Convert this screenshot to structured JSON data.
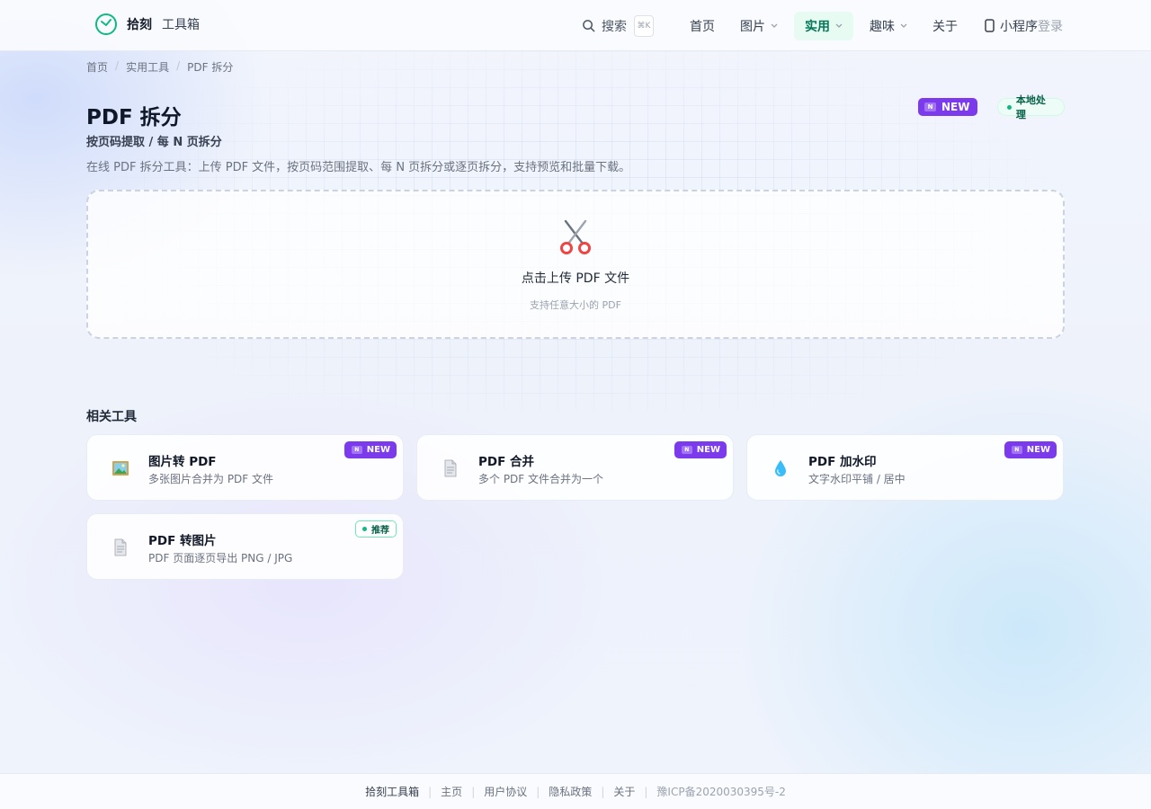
{
  "header": {
    "brand": "拾刻",
    "brand_sub": "工具箱",
    "search_label": "搜索",
    "search_shortcut": "⌘K",
    "nav": [
      "首页",
      "图片",
      "实用",
      "趣味",
      "关于"
    ],
    "mini_program": "小程序",
    "login": "登录",
    "accent": "#10b981"
  },
  "breadcrumb": [
    "首页",
    "实用工具",
    "PDF 拆分"
  ],
  "page": {
    "title": "PDF 拆分",
    "subtitle": "按页码提取 / 每 N 页拆分",
    "description": "在线 PDF 拆分工具：上传 PDF 文件，按页码范围提取、每 N 页拆分或逐页拆分，支持预览和批量下载。",
    "badge_new": "NEW",
    "badge_new_mark": "N",
    "badge_local": "本地处理"
  },
  "upload": {
    "icon": "scissors-icon",
    "title": "点击上传 PDF 文件",
    "hint": "支持任意大小的 PDF"
  },
  "related": {
    "title": "相关工具",
    "items": [
      {
        "name": "图片转 PDF",
        "desc": "多张图片合并为 PDF 文件",
        "badge": "NEW",
        "badge_mark": "N",
        "icon": "picture-icon"
      },
      {
        "name": "PDF 合并",
        "desc": "多个 PDF 文件合并为一个",
        "badge": "NEW",
        "badge_mark": "N",
        "icon": "document-icon"
      },
      {
        "name": "PDF 加水印",
        "desc": "文字水印平铺 / 居中",
        "badge": "NEW",
        "badge_mark": "N",
        "icon": "droplet-icon"
      },
      {
        "name": "PDF 转图片",
        "desc": "PDF 页面逐页导出 PNG / JPG",
        "badge": "推荐",
        "icon": "document-icon"
      }
    ]
  },
  "footer": {
    "links": [
      "拾刻工具箱",
      "主页",
      "用户协议",
      "隐私政策",
      "关于"
    ],
    "icp": "豫ICP备2020030395号-2"
  }
}
